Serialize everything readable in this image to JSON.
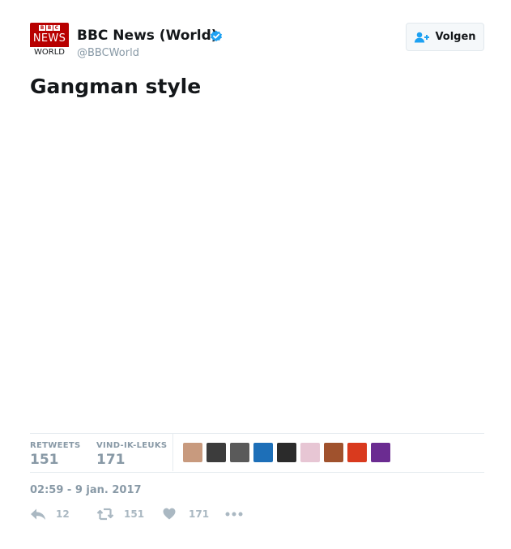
{
  "account": {
    "display_name": "BBC News (World)",
    "handle": "@BBCWorld",
    "verified": true,
    "logo": {
      "top": [
        "B",
        "B",
        "C"
      ],
      "middle": "NEWS",
      "bottom": "WORLD"
    }
  },
  "follow_button": {
    "label": "Volgen",
    "icon": "add-user-icon"
  },
  "tweet": {
    "text": "Gangman style"
  },
  "stats": {
    "retweets_label": "RETWEETS",
    "retweets_value": "151",
    "likes_label": "VIND-IK-LEUKS",
    "likes_value": "171"
  },
  "likers": [
    {
      "name": "liker-1",
      "color": "#c89a7e"
    },
    {
      "name": "liker-2",
      "color": "#3c3c3c"
    },
    {
      "name": "liker-3",
      "color": "#5a5a5a"
    },
    {
      "name": "liker-4",
      "color": "#1d6fb8"
    },
    {
      "name": "liker-5",
      "color": "#2b2b2b"
    },
    {
      "name": "liker-6",
      "color": "#e7c6d4"
    },
    {
      "name": "liker-7",
      "color": "#a0522d"
    },
    {
      "name": "liker-8",
      "color": "#d93a1e"
    },
    {
      "name": "liker-9",
      "color": "#6b2c91"
    }
  ],
  "timestamp": "02:59 - 9 jan. 2017",
  "actions": {
    "reply_count": "12",
    "retweet_count": "151",
    "like_count": "171"
  },
  "colors": {
    "muted": "#8899a6",
    "icon": "#aab8c2",
    "verified_blue": "#1da1f2",
    "bbc_red": "#b80000"
  }
}
